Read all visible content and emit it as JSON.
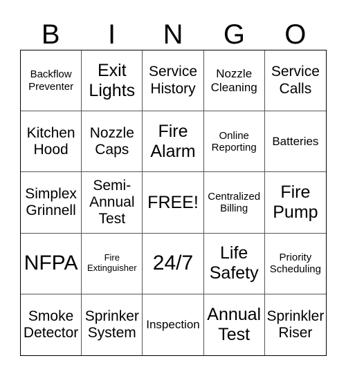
{
  "header": [
    "B",
    "I",
    "N",
    "G",
    "O"
  ],
  "cells": [
    "Backflow Preventer",
    "Exit Lights",
    "Service History",
    "Nozzle Cleaning",
    "Service Calls",
    "Kitchen Hood",
    "Nozzle Caps",
    "Fire Alarm",
    "Online Reporting",
    "Batteries",
    "Simplex Grinnell",
    "Semi- Annual Test",
    "FREE!",
    "Centralized Billing",
    "Fire Pump",
    "NFPA",
    "Fire Extinguisher",
    "24/7",
    "Life Safety",
    "Priority Scheduling",
    "Smoke Detector",
    "Sprinker System",
    "Inspection",
    "Annual Test",
    "Sprinkler Riser"
  ]
}
